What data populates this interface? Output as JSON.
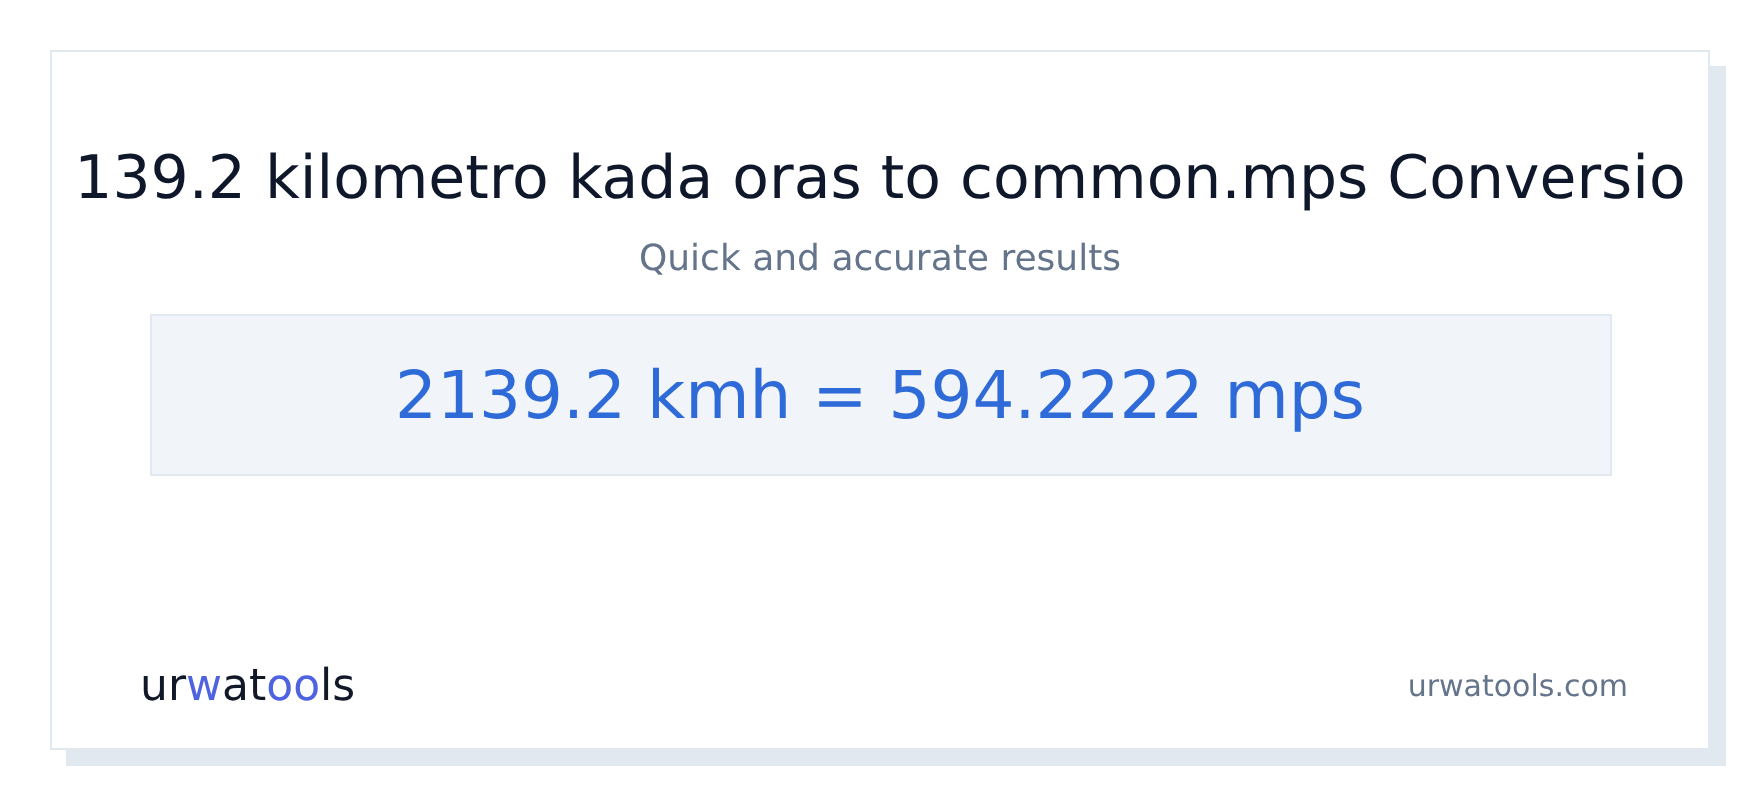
{
  "title": "139.2 kilometro kada oras to common.mps Conversio",
  "subtitle": "Quick and accurate results",
  "result": "2139.2 kmh = 594.2222 mps",
  "logo": {
    "parts": [
      {
        "text": "ur",
        "accent": false
      },
      {
        "text": "w",
        "accent": true
      },
      {
        "text": "at",
        "accent": false
      },
      {
        "text": "oo",
        "accent": true
      },
      {
        "text": "ls",
        "accent": false
      }
    ]
  },
  "site": "urwatools.com"
}
